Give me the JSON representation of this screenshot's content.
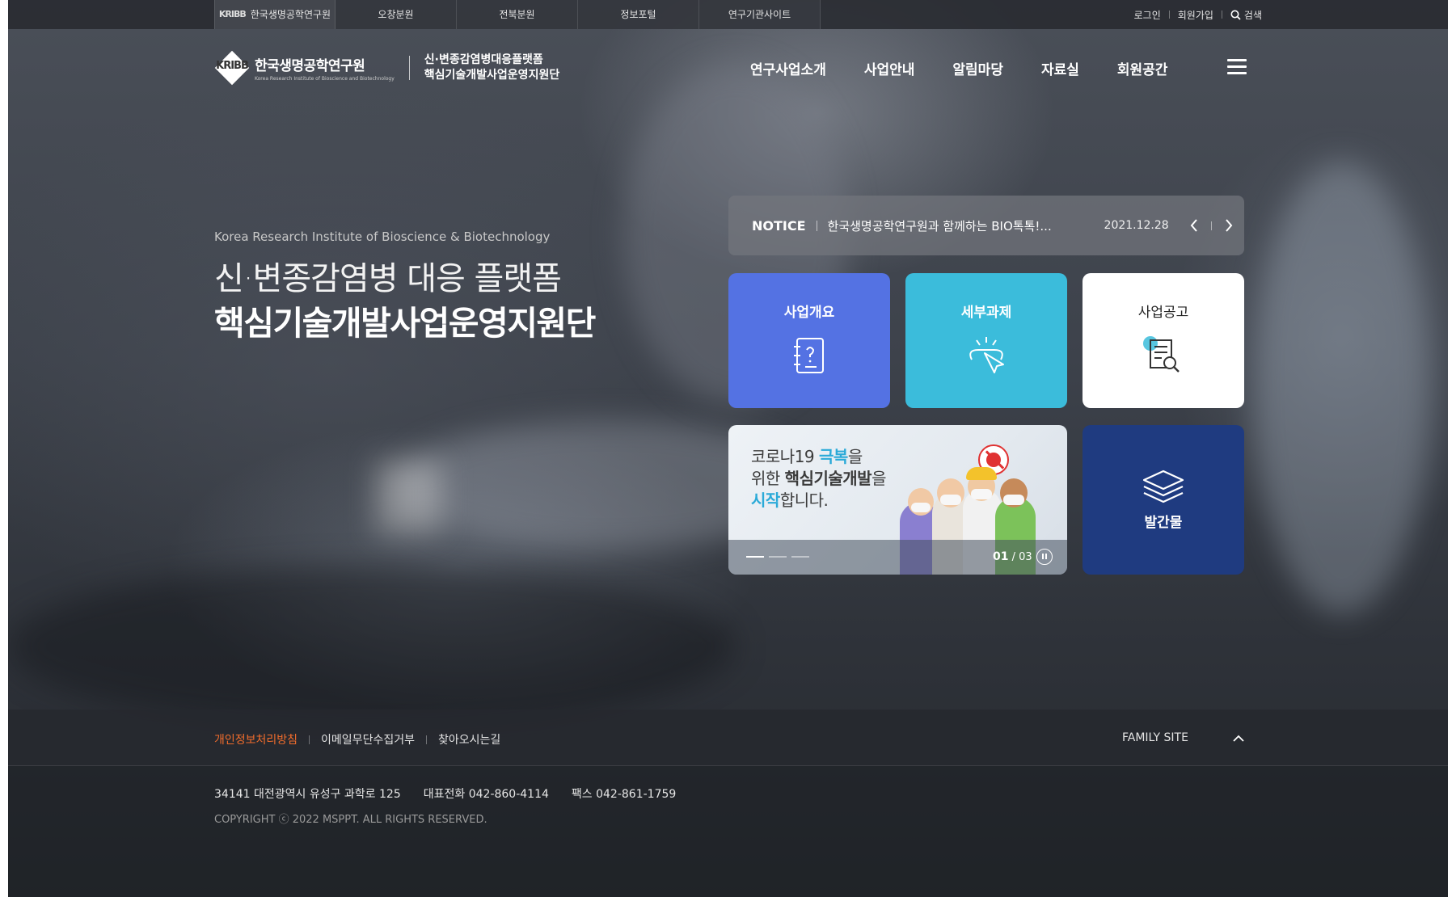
{
  "utility": {
    "sites": [
      "한국생명공학연구원",
      "오창분원",
      "전북분원",
      "정보포털",
      "연구기관사이트"
    ],
    "mini_logo": "KRIBB",
    "login": "로그인",
    "join": "회원가입",
    "search": "검색"
  },
  "header": {
    "logo_ko": "한국생명공학연구원",
    "logo_en": "Korea Research Institute of Bioscience and Biotechnology",
    "logo_mark": "KRIBB",
    "sub_line1": "신·변종감염병대응플랫폼",
    "sub_line2": "핵심기술개발사업운영지원단",
    "nav": [
      "연구사업소개",
      "사업안내",
      "알림마당",
      "자료실",
      "회원공간"
    ]
  },
  "hero": {
    "en": "Korea Research Institute of Bioscience & Biotechnology",
    "line1": "신·변종감염병 대응 플랫폼",
    "line2": "핵심기술개발사업운영지원단"
  },
  "notice": {
    "title": "NOTICE",
    "text": "한국생명공학연구원과 함께하는 BIO톡톡!...",
    "date": "2021.12.28"
  },
  "tiles": {
    "overview": "사업개요",
    "detail": "세부과제",
    "announcement": "사업공고",
    "publication": "발간물"
  },
  "banner": {
    "l1a": "코로나19 ",
    "l1b": "극복",
    "l1c": "을",
    "l2a": "위한 ",
    "l2b": "핵심기술개발",
    "l2c": "을",
    "l3a": "시작",
    "l3b": "합니다.",
    "page_current": "01",
    "page_sep": " / ",
    "page_total": "03"
  },
  "footer": {
    "privacy": "개인정보처리방침",
    "email": "이메일무단수집거부",
    "directions": "찾아오시는길",
    "family": "FAMILY SITE",
    "address": "34141 대전광역시 유성구 과학로 125",
    "phone": "대표전화 042-860-4114",
    "fax": "팩스 042-861-1759",
    "copyright": "COPYRIGHT ⓒ 2022 MSPPT. ALL RIGHTS RESERVED."
  },
  "colors": {
    "tile_overview": "#5472e3",
    "tile_detail": "#3bbcdb",
    "tile_publication": "#1f3b80",
    "privacy_link": "#f06c2c",
    "banner_highlight": "#2baad8"
  }
}
